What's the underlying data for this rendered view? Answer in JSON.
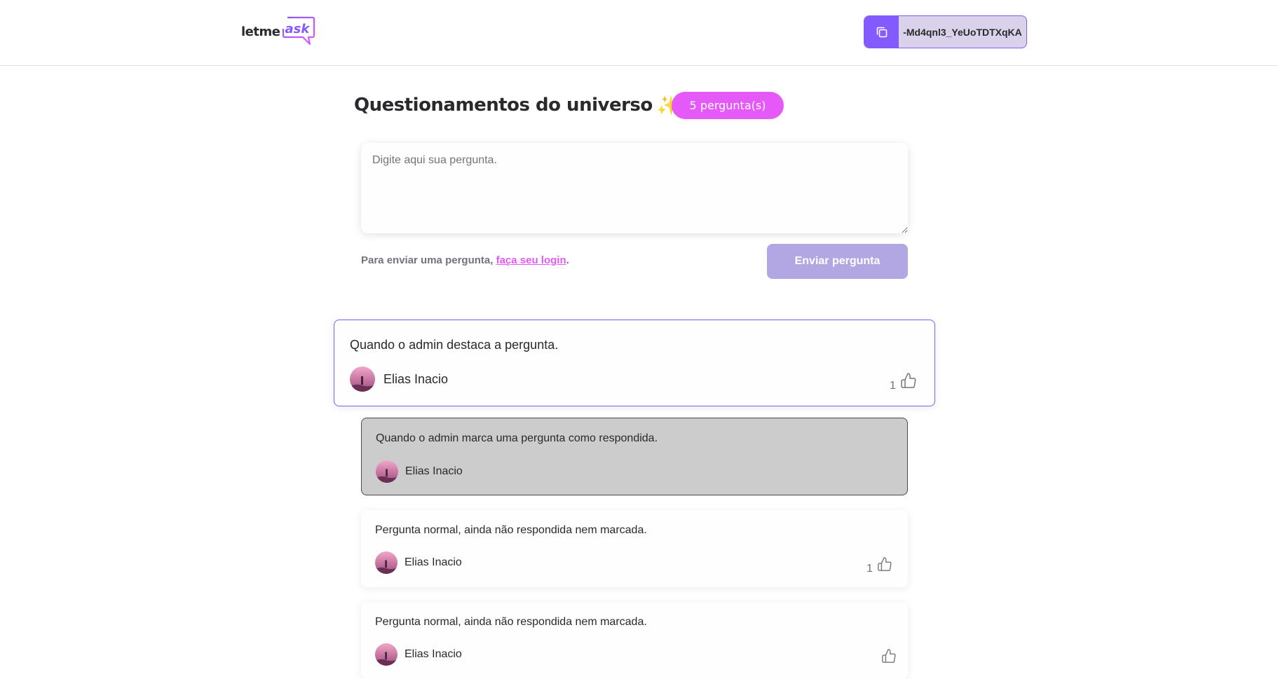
{
  "header": {
    "logo_text": "letme",
    "logo_accent": "ask",
    "room_code": "-Md4qnl3_YeUoTDTXqKA"
  },
  "room": {
    "title": "Questionamentos do universo",
    "title_emoji": "✨",
    "question_count_label": "5 pergunta(s)"
  },
  "form": {
    "placeholder": "Digite aqui sua pergunta.",
    "login_prefix": "Para enviar uma pergunta, ",
    "login_link": "faça seu login",
    "login_suffix": ".",
    "send_label": "Enviar pergunta"
  },
  "questions": [
    {
      "content": "Quando o admin destaca a pergunta.",
      "author": "Elias Inacio",
      "likes": "1",
      "state": "highlighted"
    },
    {
      "content": "Quando o admin marca uma pergunta como respondida.",
      "author": "Elias Inacio",
      "likes": "",
      "state": "answered"
    },
    {
      "content": "Pergunta normal, ainda não respondida nem marcada.",
      "author": "Elias Inacio",
      "likes": "1",
      "state": "normal"
    },
    {
      "content": "Pergunta normal, ainda não respondida nem marcada.",
      "author": "Elias Inacio",
      "likes": "",
      "state": "normal"
    }
  ],
  "colors": {
    "primary": "#835afd",
    "pink": "#e559f9",
    "answered_bg": "#cccccc"
  }
}
